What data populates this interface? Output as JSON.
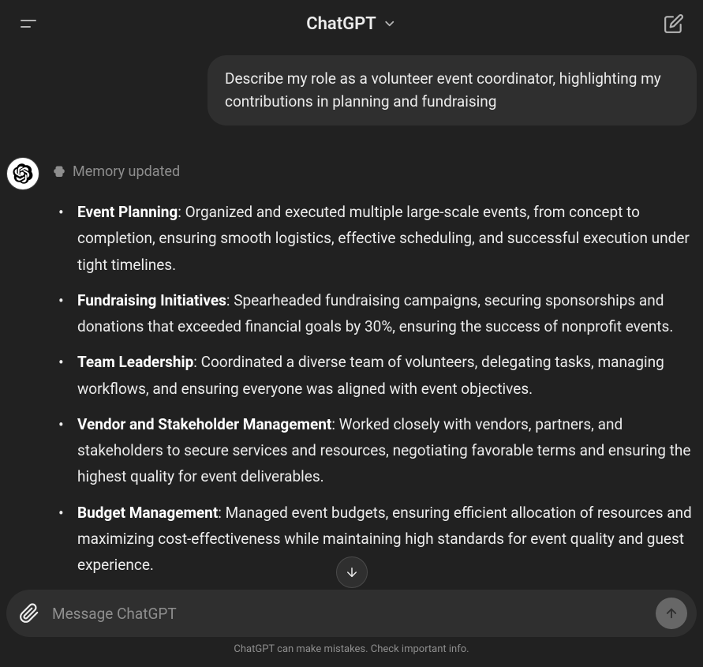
{
  "header": {
    "title": "ChatGPT"
  },
  "conversation": {
    "user_message": "Describe my role as a volunteer event coordinator, highlighting my contributions in planning and fundraising",
    "memory_status": "Memory updated",
    "bullets": [
      {
        "title": "Event Planning",
        "body": ": Organized and executed multiple large-scale events, from concept to completion, ensuring smooth logistics, effective scheduling, and successful execution under tight timelines."
      },
      {
        "title": "Fundraising Initiatives",
        "body": ": Spearheaded fundraising campaigns, securing sponsorships and donations that exceeded financial goals by 30%, ensuring the success of nonprofit events."
      },
      {
        "title": "Team Leadership",
        "body": ": Coordinated a diverse team of volunteers, delegating tasks, managing workflows, and ensuring everyone was aligned with event objectives."
      },
      {
        "title": "Vendor and Stakeholder Management",
        "body": ": Worked closely with vendors, partners, and stakeholders to secure services and resources, negotiating favorable terms and ensuring the highest quality for event deliverables."
      },
      {
        "title": "Budget Management",
        "body": ": Managed event budgets, ensuring efficient allocation of resources and maximizing cost-effectiveness while maintaining high standards for event quality and guest experience."
      }
    ]
  },
  "input": {
    "placeholder": "Message ChatGPT"
  },
  "disclaimer": "ChatGPT can make mistakes. Check important info."
}
